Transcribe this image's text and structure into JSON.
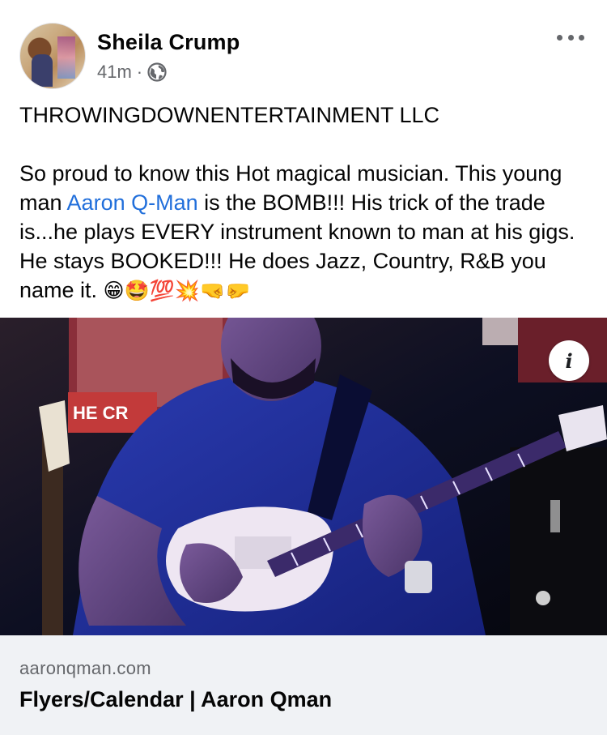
{
  "post": {
    "author": "Sheila Crump",
    "time": "41m",
    "separator": "·",
    "visibility_icon": "globe-icon",
    "more_icon": "more-options-icon"
  },
  "body": {
    "line1": "THROWINGDOWNENTERTAINMENT LLC",
    "text_before_link": "So proud to know this Hot magical musician.  This young man ",
    "link_text": "Aaron Q-Man",
    "text_after_link": " is the BOMB!!! His trick of the trade is...he plays EVERY instrument known to man at his gigs. He stays BOOKED!!! He does Jazz, Country, R&B you name it. ",
    "emojis": "😁🤩💯💥🤜🤛"
  },
  "media": {
    "info_label": "i",
    "sign_text": "HE CR",
    "description": "video-thumbnail-guitarist"
  },
  "link_card": {
    "domain": "aaronqman.com",
    "title": "Flyers/Calendar | Aaron Qman"
  },
  "colors": {
    "link": "#216fdb",
    "secondary_text": "#65676b",
    "card_background": "#f0f2f5"
  }
}
